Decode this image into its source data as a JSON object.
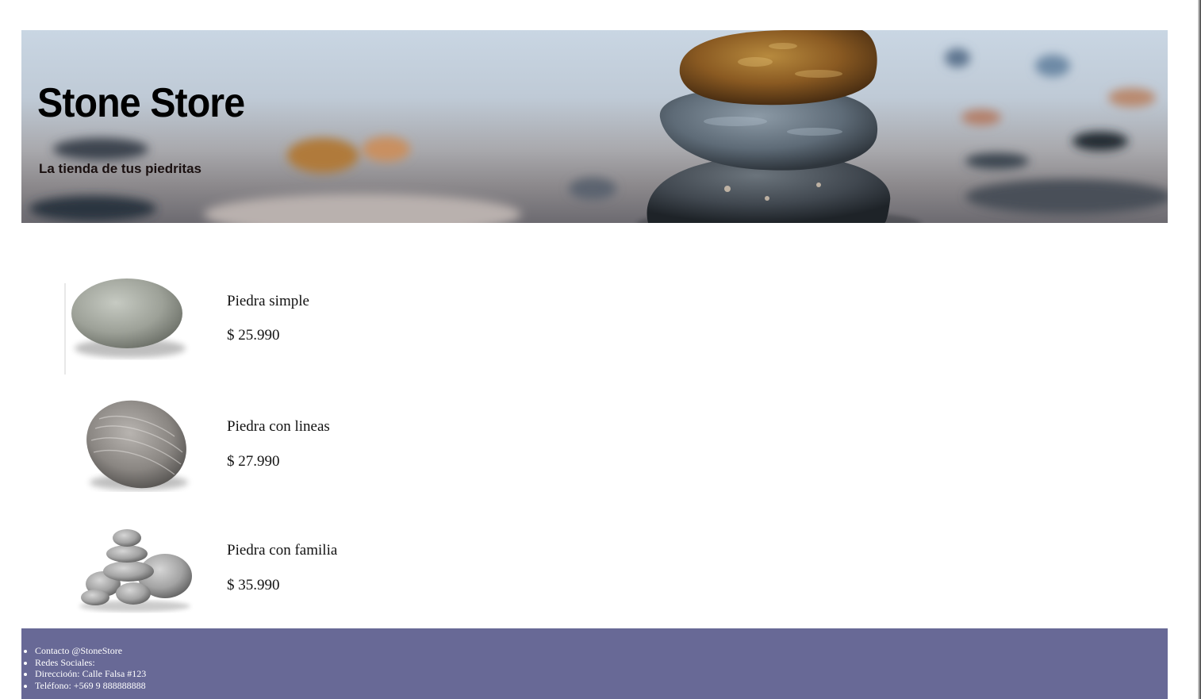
{
  "header": {
    "title": "Stone Store",
    "subtitle": "La tienda de tus piedritas"
  },
  "products": [
    {
      "name": "Piedra simple",
      "price": "$ 25.990",
      "image_icon": "smooth-stone-image"
    },
    {
      "name": "Piedra con lineas",
      "price": "$ 27.990",
      "image_icon": "striped-stone-image"
    },
    {
      "name": "Piedra con familia",
      "price": "$ 35.990",
      "image_icon": "stone-family-image"
    }
  ],
  "footer": {
    "items": [
      "Contacto @StoneStore",
      "Redes Sociales:",
      "Direccioón: Calle Falsa #123",
      "Teléfono: +569 9 888888888"
    ]
  },
  "colors": {
    "footer_bg": "#686996",
    "footer_text": "#ffffff"
  }
}
